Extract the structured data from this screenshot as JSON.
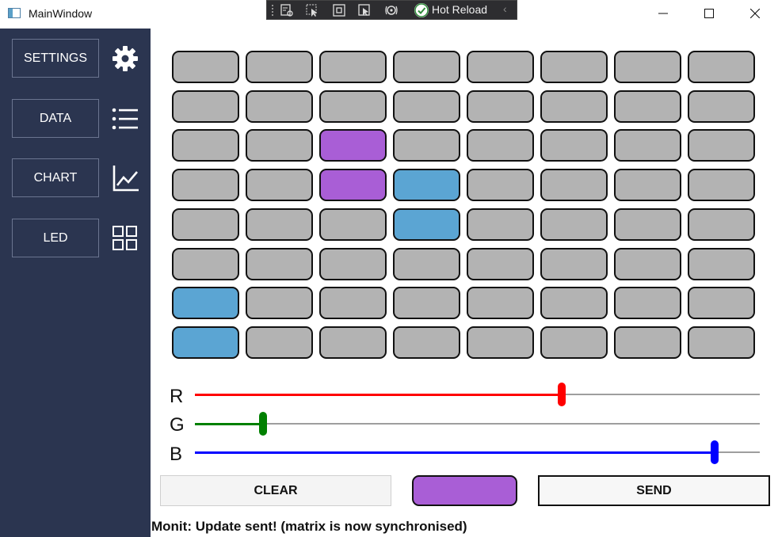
{
  "window": {
    "title": "MainWindow",
    "hot_reload_label": "Hot Reload",
    "collapse_glyph": "‹"
  },
  "sidebar": {
    "items": [
      {
        "label": "SETTINGS",
        "icon": "gear-icon"
      },
      {
        "label": "DATA",
        "icon": "list-icon"
      },
      {
        "label": "CHART",
        "icon": "line-chart-icon"
      },
      {
        "label": "LED",
        "icon": "grid-icon"
      }
    ]
  },
  "colors": {
    "off": "#b3b3b3",
    "purple": "#a95ed6",
    "blue": "#5ba5d3",
    "sidebar_bg": "#2b3550"
  },
  "matrix": {
    "rows": 8,
    "cols": 8,
    "cells": [
      [
        "off",
        "off",
        "off",
        "off",
        "off",
        "off",
        "off",
        "off"
      ],
      [
        "off",
        "off",
        "off",
        "off",
        "off",
        "off",
        "off",
        "off"
      ],
      [
        "off",
        "off",
        "purple",
        "off",
        "off",
        "off",
        "off",
        "off"
      ],
      [
        "off",
        "off",
        "purple",
        "blue",
        "off",
        "off",
        "off",
        "off"
      ],
      [
        "off",
        "off",
        "off",
        "blue",
        "off",
        "off",
        "off",
        "off"
      ],
      [
        "off",
        "off",
        "off",
        "off",
        "off",
        "off",
        "off",
        "off"
      ],
      [
        "blue",
        "off",
        "off",
        "off",
        "off",
        "off",
        "off",
        "off"
      ],
      [
        "blue",
        "off",
        "off",
        "off",
        "off",
        "off",
        "off",
        "off"
      ]
    ]
  },
  "sliders": [
    {
      "label": "R",
      "color": "#ff0000",
      "value": 0.65
    },
    {
      "label": "G",
      "color": "#008000",
      "value": 0.12
    },
    {
      "label": "B",
      "color": "#0000ff",
      "value": 0.92
    }
  ],
  "current_color": "#a95ed6",
  "buttons": {
    "clear": "CLEAR",
    "send": "SEND"
  },
  "status": "Monit: Update sent! (matrix is now synchronised)"
}
